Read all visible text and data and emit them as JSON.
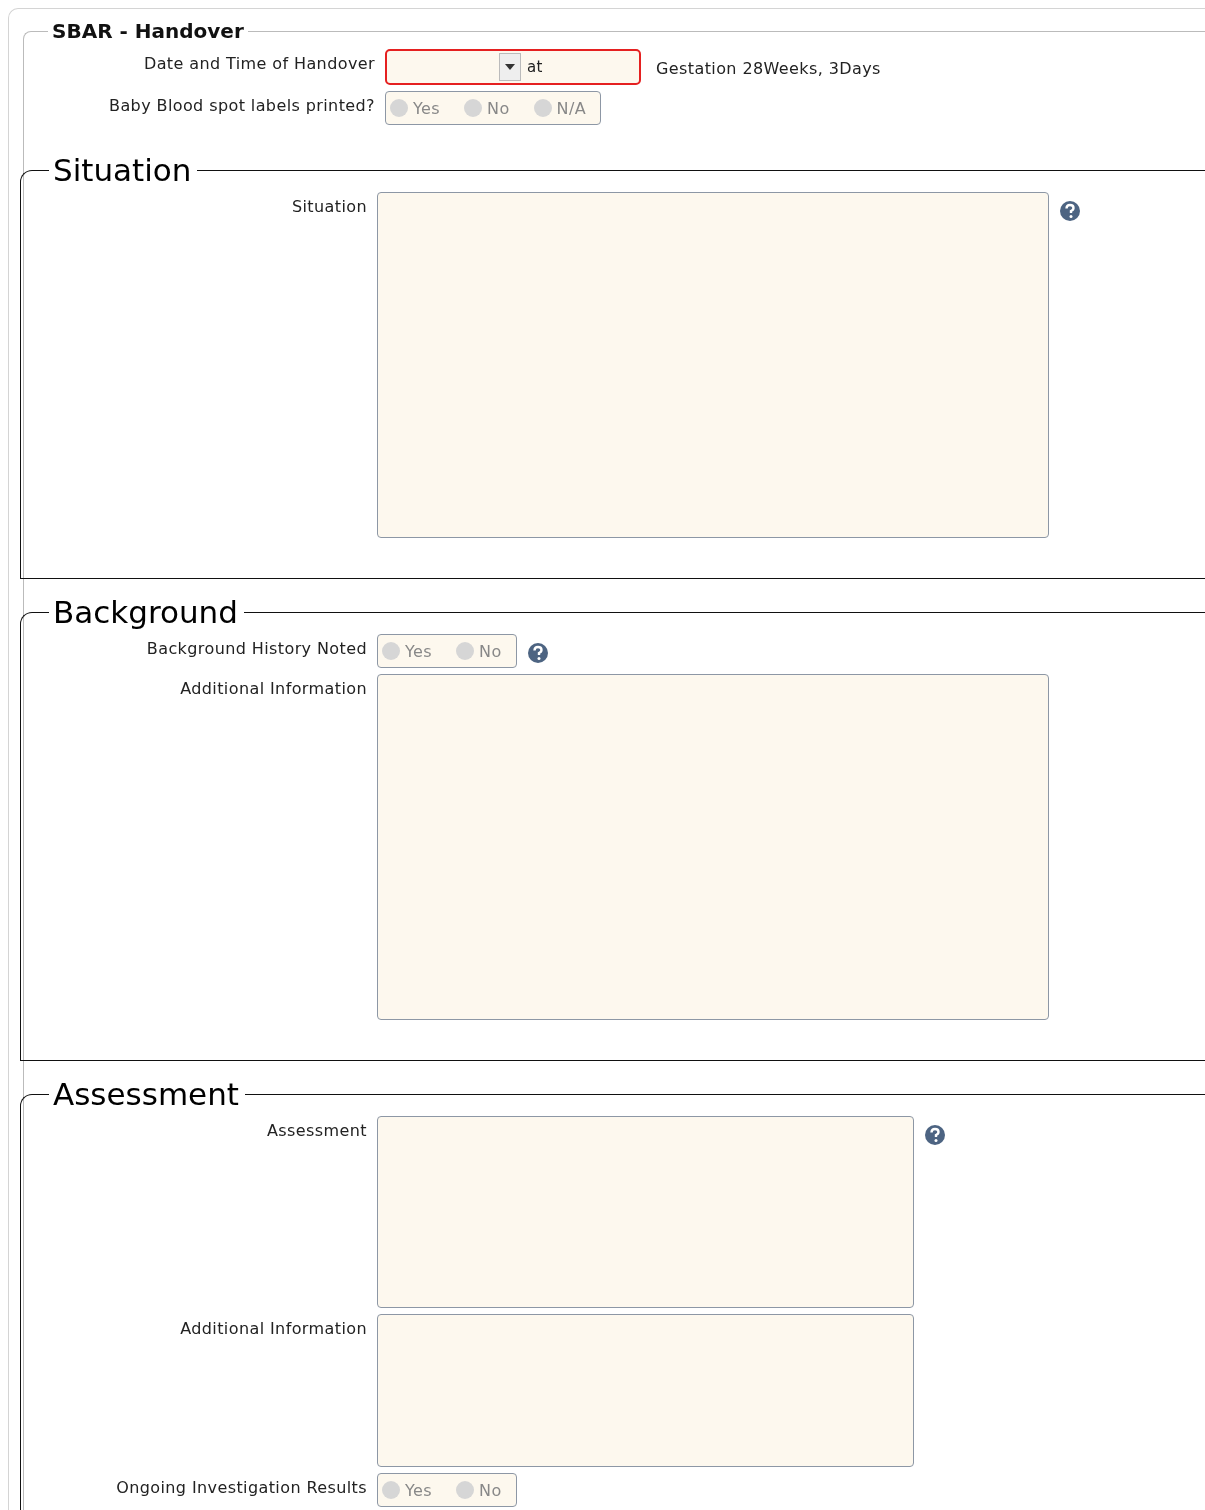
{
  "form": {
    "title": "SBAR - Handover",
    "rows": [
      {
        "kind": "datetime",
        "label": "Date and Time of Handover",
        "value": "",
        "separator": "at",
        "required": true,
        "note": "Gestation 28Weeks, 3Days"
      },
      {
        "kind": "radio",
        "label": "Baby Blood spot labels printed?",
        "options": [
          {
            "label": "Yes",
            "selected": false
          },
          {
            "label": "No",
            "selected": false
          },
          {
            "label": "N/A",
            "selected": false
          }
        ]
      }
    ]
  },
  "sections": [
    {
      "title": "Situation",
      "rows": [
        {
          "kind": "memo",
          "label": "Situation",
          "help": true
        }
      ]
    },
    {
      "title": "Background",
      "rows": [
        {
          "kind": "radio",
          "label": "Background History Noted",
          "help": true,
          "options": [
            {
              "label": "Yes",
              "selected": false
            },
            {
              "label": "No",
              "selected": false
            }
          ]
        },
        {
          "kind": "memo",
          "label": "Additional Information",
          "help": false
        }
      ]
    },
    {
      "title": "Assessment",
      "rows": [
        {
          "kind": "memo",
          "label": "Assessment",
          "help": true
        },
        {
          "kind": "memo",
          "label": "Additional Information",
          "help": false
        },
        {
          "kind": "radio",
          "label": "Ongoing Investigation Results",
          "help": false,
          "options": [
            {
              "label": "Yes",
              "selected": false
            },
            {
              "label": "No",
              "selected": false
            }
          ]
        }
      ]
    }
  ]
}
